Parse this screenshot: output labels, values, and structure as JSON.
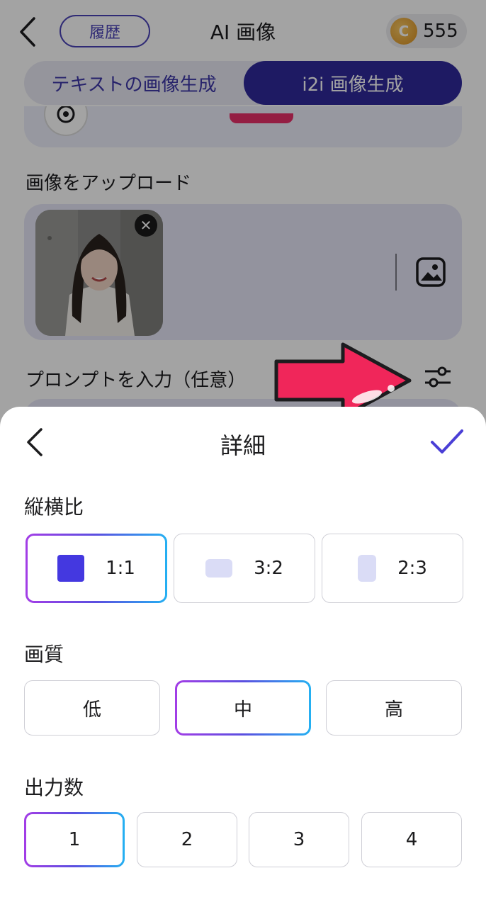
{
  "header": {
    "title": "AI 画像",
    "history_label": "履歴",
    "coin_symbol": "C",
    "coin_count": "555"
  },
  "tabs": [
    {
      "label": "テキストの画像生成",
      "active": false
    },
    {
      "label": "i2i 画像生成",
      "active": true
    }
  ],
  "upload": {
    "label": "画像をアップロード"
  },
  "prompt": {
    "label": "プロンプトを入力（任意）"
  },
  "sheet": {
    "title": "詳細",
    "aspect": {
      "label": "縦横比",
      "options": [
        "1:1",
        "3:2",
        "2:3"
      ],
      "selected": "1:1"
    },
    "quality": {
      "label": "画質",
      "options": [
        "低",
        "中",
        "高"
      ],
      "selected": "中"
    },
    "count": {
      "label": "出力数",
      "options": [
        "1",
        "2",
        "3",
        "4"
      ],
      "selected": "1"
    }
  },
  "colors": {
    "accent": "#2f2a9c",
    "selected_gradient": [
      "#a33de6",
      "#24b0f2"
    ],
    "arrow": "#f0265a"
  },
  "icons": [
    "chevron-left-icon",
    "coin-icon",
    "gallery-icon",
    "close-icon",
    "sliders-icon",
    "checkmark-icon",
    "arrow-right-icon"
  ]
}
